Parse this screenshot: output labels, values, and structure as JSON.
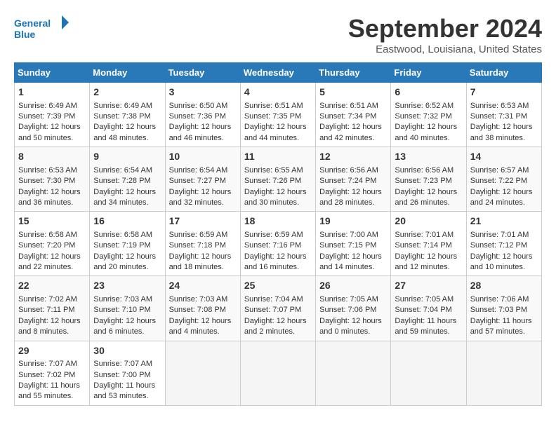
{
  "header": {
    "logo_line1": "General",
    "logo_line2": "Blue",
    "month": "September 2024",
    "location": "Eastwood, Louisiana, United States"
  },
  "weekdays": [
    "Sunday",
    "Monday",
    "Tuesday",
    "Wednesday",
    "Thursday",
    "Friday",
    "Saturday"
  ],
  "weeks": [
    [
      {
        "day": 1,
        "sunrise": "6:49 AM",
        "sunset": "7:39 PM",
        "daylight": "12 hours and 50 minutes."
      },
      {
        "day": 2,
        "sunrise": "6:49 AM",
        "sunset": "7:38 PM",
        "daylight": "12 hours and 48 minutes."
      },
      {
        "day": 3,
        "sunrise": "6:50 AM",
        "sunset": "7:36 PM",
        "daylight": "12 hours and 46 minutes."
      },
      {
        "day": 4,
        "sunrise": "6:51 AM",
        "sunset": "7:35 PM",
        "daylight": "12 hours and 44 minutes."
      },
      {
        "day": 5,
        "sunrise": "6:51 AM",
        "sunset": "7:34 PM",
        "daylight": "12 hours and 42 minutes."
      },
      {
        "day": 6,
        "sunrise": "6:52 AM",
        "sunset": "7:32 PM",
        "daylight": "12 hours and 40 minutes."
      },
      {
        "day": 7,
        "sunrise": "6:53 AM",
        "sunset": "7:31 PM",
        "daylight": "12 hours and 38 minutes."
      }
    ],
    [
      {
        "day": 8,
        "sunrise": "6:53 AM",
        "sunset": "7:30 PM",
        "daylight": "12 hours and 36 minutes."
      },
      {
        "day": 9,
        "sunrise": "6:54 AM",
        "sunset": "7:28 PM",
        "daylight": "12 hours and 34 minutes."
      },
      {
        "day": 10,
        "sunrise": "6:54 AM",
        "sunset": "7:27 PM",
        "daylight": "12 hours and 32 minutes."
      },
      {
        "day": 11,
        "sunrise": "6:55 AM",
        "sunset": "7:26 PM",
        "daylight": "12 hours and 30 minutes."
      },
      {
        "day": 12,
        "sunrise": "6:56 AM",
        "sunset": "7:24 PM",
        "daylight": "12 hours and 28 minutes."
      },
      {
        "day": 13,
        "sunrise": "6:56 AM",
        "sunset": "7:23 PM",
        "daylight": "12 hours and 26 minutes."
      },
      {
        "day": 14,
        "sunrise": "6:57 AM",
        "sunset": "7:22 PM",
        "daylight": "12 hours and 24 minutes."
      }
    ],
    [
      {
        "day": 15,
        "sunrise": "6:58 AM",
        "sunset": "7:20 PM",
        "daylight": "12 hours and 22 minutes."
      },
      {
        "day": 16,
        "sunrise": "6:58 AM",
        "sunset": "7:19 PM",
        "daylight": "12 hours and 20 minutes."
      },
      {
        "day": 17,
        "sunrise": "6:59 AM",
        "sunset": "7:18 PM",
        "daylight": "12 hours and 18 minutes."
      },
      {
        "day": 18,
        "sunrise": "6:59 AM",
        "sunset": "7:16 PM",
        "daylight": "12 hours and 16 minutes."
      },
      {
        "day": 19,
        "sunrise": "7:00 AM",
        "sunset": "7:15 PM",
        "daylight": "12 hours and 14 minutes."
      },
      {
        "day": 20,
        "sunrise": "7:01 AM",
        "sunset": "7:14 PM",
        "daylight": "12 hours and 12 minutes."
      },
      {
        "day": 21,
        "sunrise": "7:01 AM",
        "sunset": "7:12 PM",
        "daylight": "12 hours and 10 minutes."
      }
    ],
    [
      {
        "day": 22,
        "sunrise": "7:02 AM",
        "sunset": "7:11 PM",
        "daylight": "12 hours and 8 minutes."
      },
      {
        "day": 23,
        "sunrise": "7:03 AM",
        "sunset": "7:10 PM",
        "daylight": "12 hours and 6 minutes."
      },
      {
        "day": 24,
        "sunrise": "7:03 AM",
        "sunset": "7:08 PM",
        "daylight": "12 hours and 4 minutes."
      },
      {
        "day": 25,
        "sunrise": "7:04 AM",
        "sunset": "7:07 PM",
        "daylight": "12 hours and 2 minutes."
      },
      {
        "day": 26,
        "sunrise": "7:05 AM",
        "sunset": "7:06 PM",
        "daylight": "12 hours and 0 minutes."
      },
      {
        "day": 27,
        "sunrise": "7:05 AM",
        "sunset": "7:04 PM",
        "daylight": "11 hours and 59 minutes."
      },
      {
        "day": 28,
        "sunrise": "7:06 AM",
        "sunset": "7:03 PM",
        "daylight": "11 hours and 57 minutes."
      }
    ],
    [
      {
        "day": 29,
        "sunrise": "7:07 AM",
        "sunset": "7:02 PM",
        "daylight": "11 hours and 55 minutes."
      },
      {
        "day": 30,
        "sunrise": "7:07 AM",
        "sunset": "7:00 PM",
        "daylight": "11 hours and 53 minutes."
      },
      null,
      null,
      null,
      null,
      null
    ]
  ]
}
